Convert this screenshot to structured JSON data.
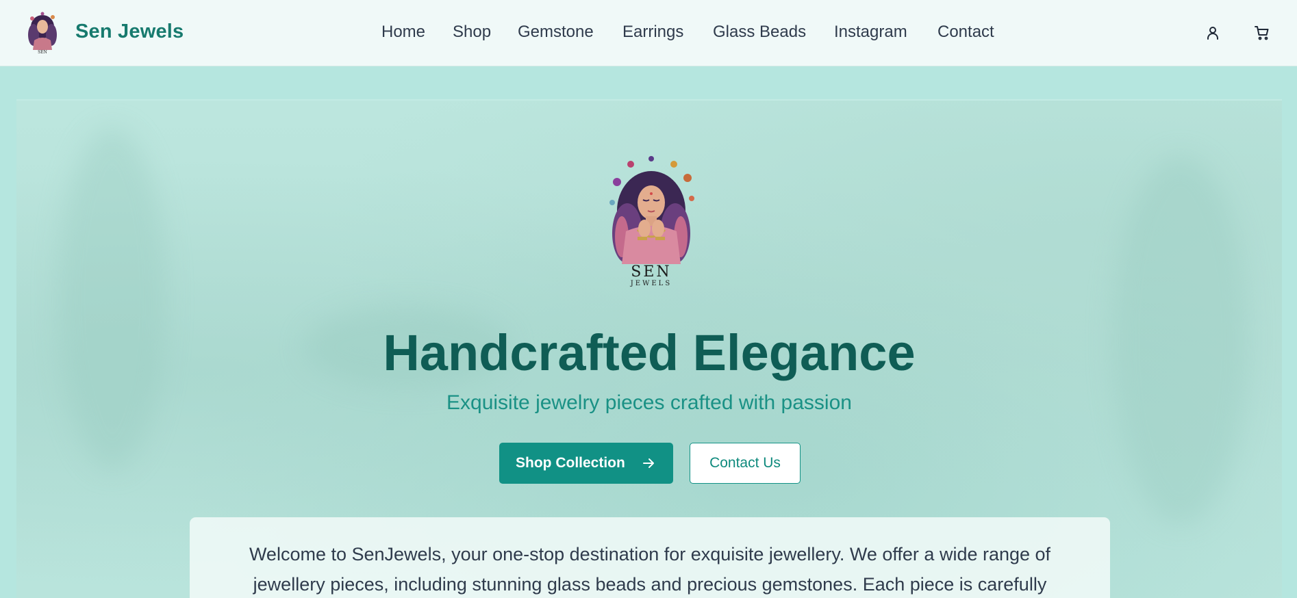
{
  "header": {
    "brand": "Sen Jewels",
    "logo_icon": "sen-jewels-woman-logo",
    "nav": [
      {
        "label": "Home"
      },
      {
        "label": "Shop"
      },
      {
        "label": "Gemstone"
      },
      {
        "label": "Earrings"
      },
      {
        "label": "Glass Beads"
      },
      {
        "label": "Instagram"
      },
      {
        "label": "Contact"
      }
    ],
    "icons": [
      "user-icon",
      "cart-icon"
    ]
  },
  "hero": {
    "logo_text": "SEN",
    "logo_subtext": "JEWELS",
    "title": "Handcrafted Elegance",
    "subtitle": "Exquisite jewelry pieces crafted with passion",
    "primary_button": "Shop Collection",
    "secondary_button": "Contact Us",
    "welcome_text": "Welcome to SenJewels, your one-stop destination for exquisite jewellery. We offer a wide range of jewellery pieces, including stunning glass beads and precious gemstones. Each piece is carefully"
  },
  "colors": {
    "accent": "#119185",
    "brand_text": "#177a6e",
    "title": "#0f5d55",
    "subtitle": "#1a9185",
    "page_bg": "#b5e6df",
    "header_bg": "#f0f9f8"
  }
}
